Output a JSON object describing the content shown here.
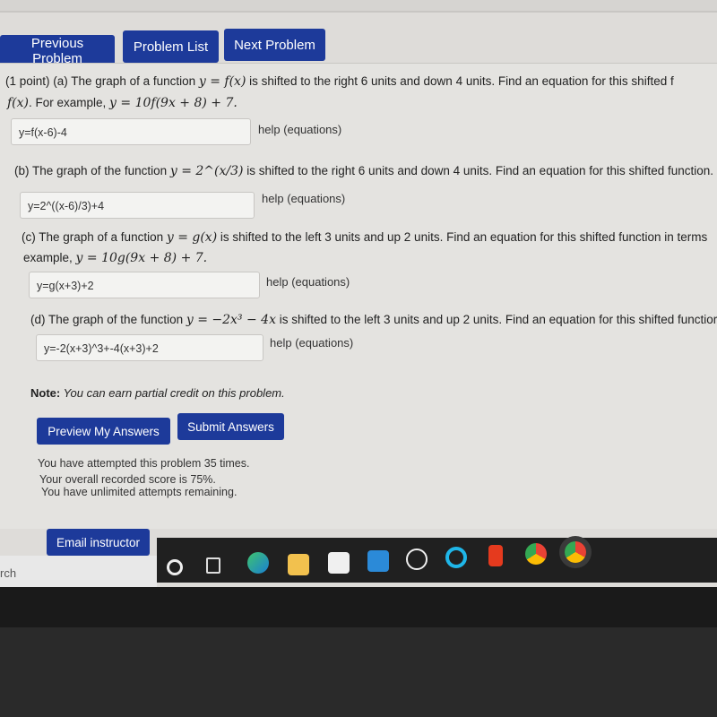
{
  "nav": {
    "previous": "Previous Problem",
    "list": "Problem List",
    "next": "Next Problem"
  },
  "parts": [
    {
      "line1": "(1 point) (a) The graph of a function ",
      "math1": "y = f(x)",
      "rest1": " is shifted to the right 6 units and down 4 units. Find an equation for this shifted f",
      "line2_math": "f(x)",
      "line2_text": ". For example, ",
      "line2_ex": "y = 10f(9x + 8) + 7.",
      "answer": "y=f(x-6)-4",
      "help": "help (equations)"
    },
    {
      "line1": "(b) The graph of the function ",
      "math1": "y = 2^(x/3)",
      "rest1": " is shifted to the right 6 units and down 4 units. Find an equation for this shifted function.",
      "answer": "y=2^((x-6)/3)+4",
      "help": "help (equations)"
    },
    {
      "line1": "(c) The graph of a function ",
      "math1": "y = g(x)",
      "rest1": " is shifted to the left 3 units and up 2 units. Find an equation for this shifted function in terms",
      "line2_text": "example, ",
      "line2_ex": "y = 10g(9x + 8) + 7.",
      "answer": "y=g(x+3)+2",
      "help": "help (equations)"
    },
    {
      "line1": "(d) The graph of the function ",
      "math1": "y = −2x³ − 4x",
      "rest1": " is shifted to the left 3 units and up 2 units. Find an equation for this shifted functior",
      "answer": "y=-2(x+3)^3+-4(x+3)+2",
      "help": "help (equations)"
    }
  ],
  "note_label": "Note:",
  "note_text": " You can earn partial credit on this problem.",
  "buttons": {
    "preview": "Preview My Answers",
    "submit": "Submit Answers",
    "email": "Email instructor"
  },
  "status": [
    "You have attempted this problem 35 times.",
    "Your overall recorded score is 75%.",
    "You have unlimited attempts remaining."
  ],
  "taskbar": {
    "search_fragment": "rch",
    "icons": [
      "cortana-circle-icon",
      "task-view-icon",
      "edge-icon",
      "file-explorer-icon",
      "store-icon",
      "mail-icon",
      "dell-icon",
      "alexa-icon",
      "office-icon",
      "chrome-icon",
      "chrome-profile-icon"
    ]
  }
}
